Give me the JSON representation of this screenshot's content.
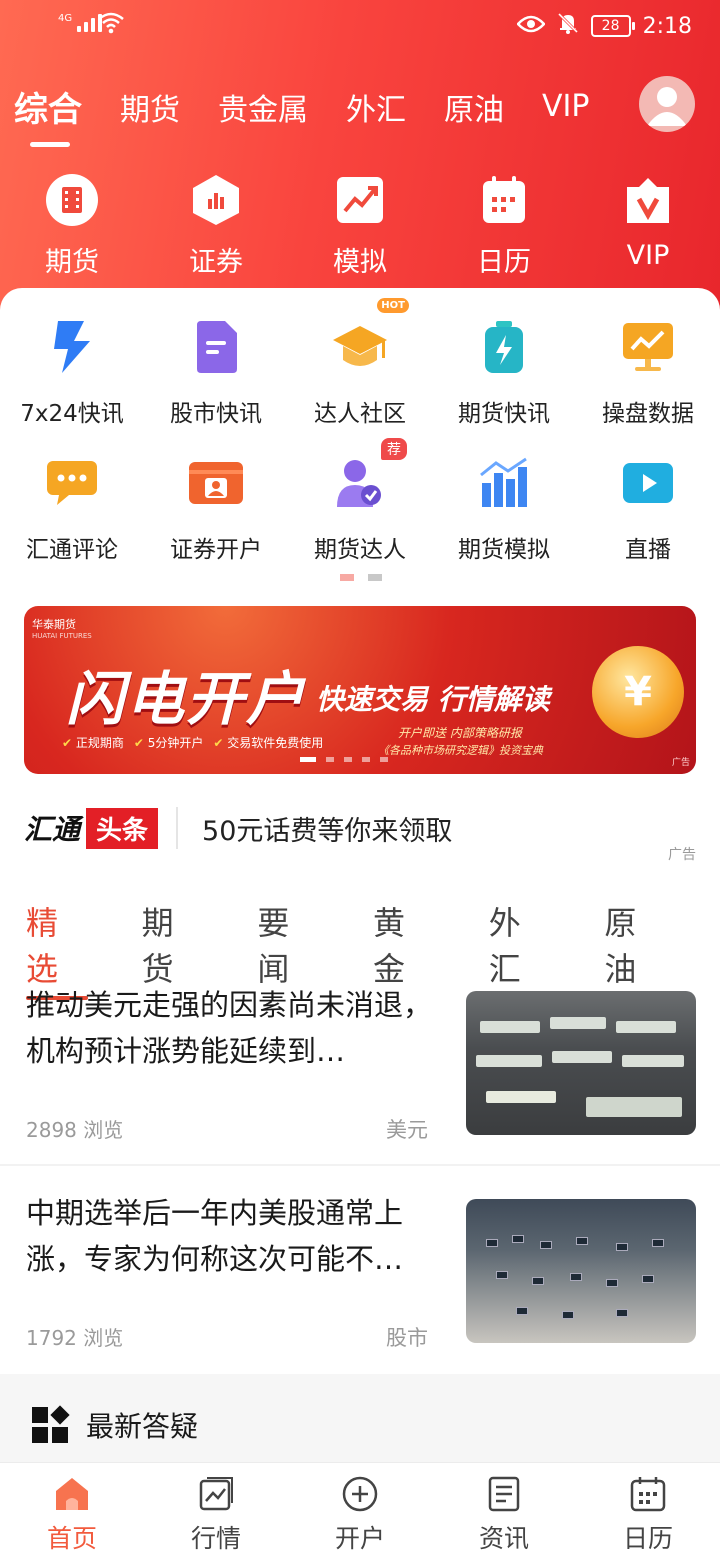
{
  "status_bar": {
    "network": "4G",
    "battery": "28",
    "time": "2:18"
  },
  "top_tabs": [
    {
      "label": "综合",
      "active": true
    },
    {
      "label": "期货"
    },
    {
      "label": "贵金属"
    },
    {
      "label": "外汇"
    },
    {
      "label": "原油"
    },
    {
      "label": "VIP"
    }
  ],
  "quick_links": [
    {
      "label": "期货",
      "icon": "film-icon"
    },
    {
      "label": "证券",
      "icon": "bar-chart-icon"
    },
    {
      "label": "模拟",
      "icon": "trend-icon"
    },
    {
      "label": "日历",
      "icon": "calendar-icon"
    },
    {
      "label": "VIP",
      "icon": "vip-icon"
    }
  ],
  "grid": {
    "row1": [
      {
        "label": "7x24快讯",
        "icon": "lightning-icon"
      },
      {
        "label": "股市快讯",
        "icon": "document-icon"
      },
      {
        "label": "达人社区",
        "icon": "graduation-cap-icon",
        "badge": "HOT"
      },
      {
        "label": "期货快讯",
        "icon": "battery-bolt-icon"
      },
      {
        "label": "操盘数据",
        "icon": "monitor-chart-icon"
      }
    ],
    "row2": [
      {
        "label": "汇通评论",
        "icon": "chat-icon"
      },
      {
        "label": "证券开户",
        "icon": "id-card-icon"
      },
      {
        "label": "期货达人",
        "icon": "user-badge-icon",
        "badge": "荐"
      },
      {
        "label": "期货模拟",
        "icon": "bar-graph-icon"
      },
      {
        "label": "直播",
        "icon": "video-play-icon"
      }
    ]
  },
  "banner": {
    "brand": "华泰期货",
    "brand_en": "HUATAI FUTURES",
    "title": "闪电开户",
    "subtitle": "快速交易 行情解读",
    "bullets": [
      "正规期商",
      "5分钟开户",
      "交易软件免费使用"
    ],
    "line1": "开户即送 内部策略研报",
    "line2": "《各品种市场研究逻辑》投资宝典",
    "coin": "¥",
    "ad_label": "广告"
  },
  "headline": {
    "logo_text": "汇通",
    "logo_tag": "头条",
    "text": "50元话费等你来领取",
    "ad_label": "广告"
  },
  "news_tabs": [
    {
      "label": "精选",
      "active": true
    },
    {
      "label": "期货"
    },
    {
      "label": "要闻"
    },
    {
      "label": "黄金"
    },
    {
      "label": "外汇"
    },
    {
      "label": "原油"
    }
  ],
  "articles": [
    {
      "title": "推动美元走强的因素尚未消退，机构预计涨势能延续到…",
      "views": "2898 浏览",
      "tag": "美元"
    },
    {
      "title": "中期选举后一年内美股通常上涨，专家为何称这次可能不…",
      "views": "1792 浏览",
      "tag": "股市"
    }
  ],
  "qa": {
    "title": "最新答疑"
  },
  "bottom_nav": [
    {
      "label": "首页",
      "icon": "home-icon",
      "active": true
    },
    {
      "label": "行情",
      "icon": "chart-icon"
    },
    {
      "label": "开户",
      "icon": "plus-circle-icon"
    },
    {
      "label": "资讯",
      "icon": "news-icon"
    },
    {
      "label": "日历",
      "icon": "calendar-icon"
    }
  ],
  "colors": {
    "header": "#f9443e",
    "accent": "#e84b35",
    "nav_active": "#f25a3d"
  }
}
